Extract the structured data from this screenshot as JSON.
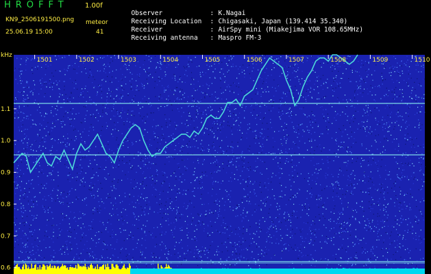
{
  "header": {
    "app_title": "HROFFT",
    "version": "1.00f",
    "file_name": "KN9_2506191500.png",
    "meteor_label": "meteor",
    "meteor_count": "41",
    "datetime": "25.06.19 15:00"
  },
  "info": [
    {
      "label": "Observer",
      "value": "K.Nagai"
    },
    {
      "label": "Receiving Location",
      "value": "Chigasaki, Japan (139.414 35.340)"
    },
    {
      "label": "Receiver",
      "value": "AirSpy mini (Miakejima VOR 108.65MHz)"
    },
    {
      "label": "Receiving antenna",
      "value": "Maspro FM-3"
    }
  ],
  "colors": {
    "background": "#000000",
    "spectrogram_base": "#1a22b0",
    "signal_trace": "#4dd8d8",
    "reference_line": "#88eeee",
    "meteor_bars": "#ffff00",
    "noise_band": "#00d8f0",
    "label_text": "#ffee44"
  },
  "chart_data": {
    "type": "line",
    "ylabel": "kHz",
    "ylim": [
      0.58,
      1.27
    ],
    "xlim": [
      1500.5,
      1510.3
    ],
    "x_ticks": [
      "1501",
      "1502",
      "1503",
      "1504",
      "1505",
      "1506",
      "1507",
      "1508",
      "1509",
      "1510"
    ],
    "x_tick_values": [
      1501,
      1502,
      1503,
      1504,
      1505,
      1506,
      1507,
      1508,
      1509,
      1510
    ],
    "y_ticks": [
      "1.1",
      "1.0",
      "0.9",
      "0.8",
      "0.7",
      "0.6"
    ],
    "y_tick_values": [
      1.1,
      1.0,
      0.9,
      0.8,
      0.7,
      0.6
    ],
    "reference_lines": [
      1.117,
      0.955,
      0.619
    ],
    "series": [
      {
        "x": [
          1500.5,
          1500.7,
          1500.8,
          1500.9,
          1501.0,
          1501.1,
          1501.2,
          1501.3,
          1501.4,
          1501.5,
          1501.6,
          1501.7,
          1501.8,
          1501.9,
          1502.0,
          1502.1,
          1502.2,
          1502.3,
          1502.4,
          1502.5,
          1502.6,
          1502.7,
          1502.8,
          1502.9,
          1503.0,
          1503.1,
          1503.2,
          1503.3,
          1503.4,
          1503.5,
          1503.6,
          1503.7,
          1503.8,
          1503.9,
          1504.0,
          1504.1,
          1504.2,
          1504.3,
          1504.4,
          1504.5,
          1504.6,
          1504.7,
          1504.8,
          1504.9,
          1505.0,
          1505.1,
          1505.2,
          1505.3,
          1505.4,
          1505.5,
          1505.6,
          1505.7,
          1505.8,
          1505.9,
          1506.0,
          1506.1,
          1506.2,
          1506.3,
          1506.4,
          1506.5,
          1506.6,
          1506.7,
          1506.8,
          1506.9,
          1507.0,
          1507.1,
          1507.2,
          1507.3,
          1507.4,
          1507.5,
          1507.6,
          1507.7,
          1507.8,
          1507.9,
          1508.0,
          1508.1,
          1508.2,
          1508.3,
          1508.4,
          1508.5,
          1508.6,
          1508.7
        ],
        "y": [
          0.93,
          0.96,
          0.95,
          0.9,
          0.92,
          0.94,
          0.96,
          0.93,
          0.92,
          0.95,
          0.94,
          0.97,
          0.94,
          0.91,
          0.96,
          0.99,
          0.97,
          0.98,
          1.0,
          1.02,
          0.99,
          0.96,
          0.95,
          0.93,
          0.97,
          1.0,
          1.02,
          1.04,
          1.05,
          1.04,
          1.0,
          0.97,
          0.95,
          0.96,
          0.96,
          0.98,
          0.99,
          1.0,
          1.01,
          1.02,
          1.02,
          1.01,
          1.03,
          1.02,
          1.04,
          1.07,
          1.08,
          1.07,
          1.07,
          1.09,
          1.12,
          1.12,
          1.13,
          1.11,
          1.14,
          1.15,
          1.16,
          1.19,
          1.22,
          1.24,
          1.26,
          1.25,
          1.24,
          1.23,
          1.19,
          1.16,
          1.11,
          1.13,
          1.17,
          1.2,
          1.22,
          1.25,
          1.26,
          1.26,
          1.25,
          1.27,
          1.27,
          1.26,
          1.25,
          1.24,
          1.25,
          1.27
        ]
      }
    ],
    "meteor_bars_level": 0.95,
    "noise_level": 0.4
  }
}
